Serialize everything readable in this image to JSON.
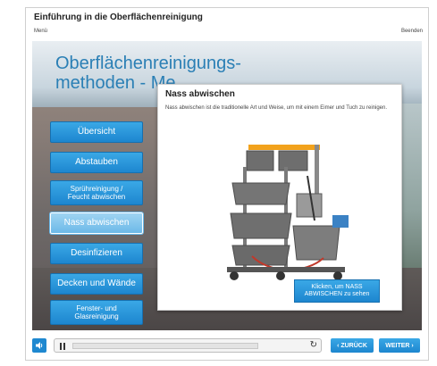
{
  "header": {
    "course_title": "Einführung in die Oberflächenreinigung",
    "menu_label": "Menü",
    "end_label": "Beenden"
  },
  "stage": {
    "title": "Oberflächenreinigungs-\nmethoden - Me"
  },
  "nav": {
    "items": [
      {
        "label": "Übersicht",
        "active": false
      },
      {
        "label": "Abstauben",
        "active": false
      },
      {
        "label": "Sprühreinigung /\nFeucht abwischen",
        "active": false
      },
      {
        "label": "Nass abwischen",
        "active": true
      },
      {
        "label": "Desinfizieren",
        "active": false
      },
      {
        "label": "Decken und Wände",
        "active": false
      },
      {
        "label": "Fenster- und\nGlasreinigung",
        "active": false
      }
    ]
  },
  "popup": {
    "title": "Nass abwischen",
    "text": "Nass abwischen ist die traditionelle Art und Weise, um mit einem Eimer und Tuch zu reinigen.",
    "button_label": "Klicken, um NASS ABWISCHEN zu sehen"
  },
  "controls": {
    "audio_icon": "speaker-icon",
    "pause_icon": "pause-icon",
    "replay_icon": "replay-icon",
    "back_label": "‹ ZURÜCK",
    "next_label": "WEITER ›",
    "progress": 0.0
  },
  "colors": {
    "accent": "#1d86cf",
    "title_blue": "#2a7fb5"
  }
}
